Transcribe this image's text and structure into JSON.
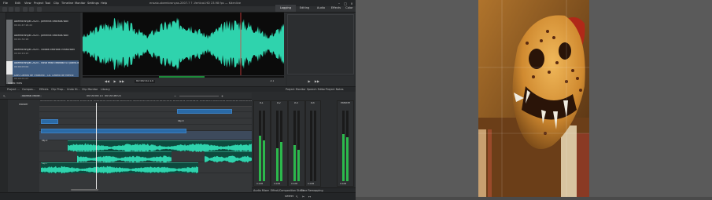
{
  "window": {
    "title": "ensaio-obembranças-2007-? ? -Vertical-HD 23.98 fps — Kdenlive"
  },
  "menu": [
    "File",
    "Edit",
    "View",
    "Project",
    "Tool",
    "Clip",
    "Timeline",
    "Monitor",
    "Settings",
    "Help"
  ],
  "workspaces": [
    "Logging",
    "Editing",
    "Audio",
    "Effects",
    "Color"
  ],
  "bin": {
    "items": [
      {
        "name": "Abembranças 2025 - pimenta cebrada.wav",
        "meta": "00:01:47:18.22"
      },
      {
        "name": "Abembranças 2025 - pimenta cebrada.wav",
        "meta": "00:01:32:18"
      },
      {
        "name": "Abembranças 2025 - colaba cebrada Vilhão.wav",
        "meta": "00:02:16:15"
      },
      {
        "name": "Abembranças 2025 - nova mita cebrada 03 plano.wav",
        "meta": "00:00:03:04"
      },
      {
        "name": "Dois Cantos de Trabalho - Co. Cebelo de Mercio",
        "meta": "00:00:01:07"
      }
    ],
    "footer": "Video Files"
  },
  "monitor": {
    "timecode": "00:00:01:14",
    "zoom": "1:1"
  },
  "tabs_top": [
    "Project ...",
    "Compos...",
    "Effects",
    "Clip Prop...",
    "Undo Hi...",
    "Clip Monitor",
    "Library"
  ],
  "tabs_proj": [
    "Project Monitor",
    "Speech Editor",
    "Project Notes"
  ],
  "timeline": {
    "mode": "Normal Mode",
    "timecode_a": "00:00:00:13",
    "timecode_b": "00:00:36:03",
    "master": "Master",
    "ruler": [
      "00:00:00:00",
      "00:00:04:01",
      "00:00:08:02",
      "00:00:12:04",
      "00:00:16:05",
      "00:00:20:06",
      "00:00:24:07",
      "00:00:28:09",
      "00:00:32:10",
      "00:00:36:11",
      "00:00:40:12",
      "00:00:44:14",
      "00:00:48:15",
      "00:00:52:16",
      "00:00:56:18",
      "00:01:00:19"
    ],
    "clips": [
      "Clip 0",
      "Clip 1",
      "Clip 2",
      "Clip 3",
      "Clip 4"
    ]
  },
  "mixer": {
    "channels": [
      "A1",
      "A2",
      "A3",
      "A4",
      "Master"
    ],
    "values": [
      "0.0dB",
      "0.0dB",
      "0.0dB",
      "0.0dB",
      "0.0dB"
    ]
  },
  "tabs_bottom": [
    "Audio Mixer",
    "Effect/Composition Stack",
    "Time Remapping"
  ],
  "status": {
    "left": "Select"
  }
}
